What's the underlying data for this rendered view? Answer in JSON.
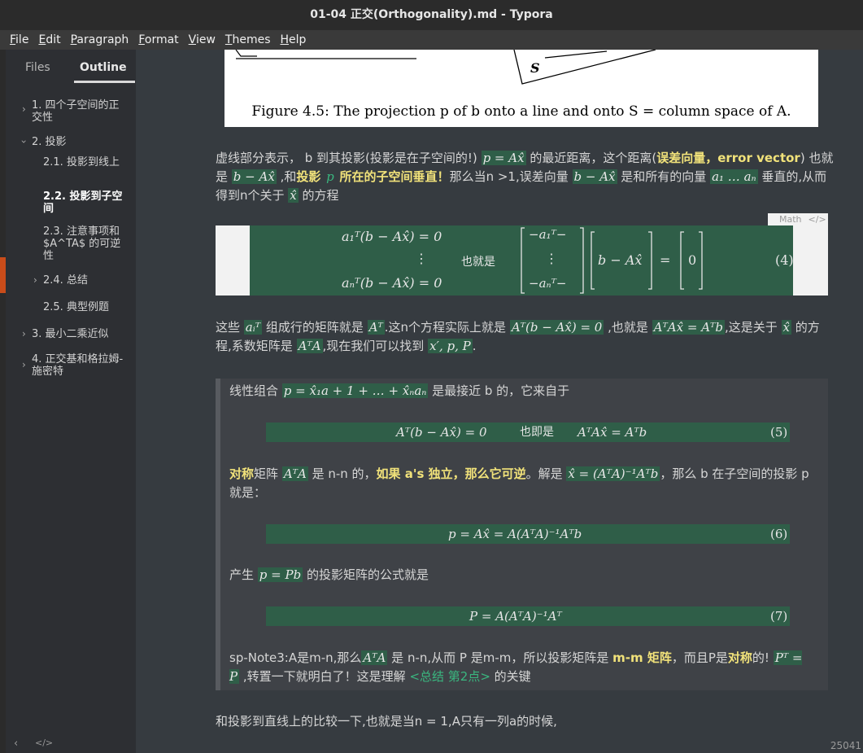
{
  "window": {
    "title": "01-04 正交(Orthogonality).md - Typora"
  },
  "menu": {
    "file": "File",
    "edit": "Edit",
    "paragraph": "Paragraph",
    "format": "Format",
    "view": "View",
    "themes": "Themes",
    "help": "Help"
  },
  "sidebar": {
    "tabs": {
      "files": "Files",
      "outline": "Outline"
    },
    "items": [
      {
        "label": "1. 四个子空间的正交性"
      },
      {
        "label": "2. 投影"
      },
      {
        "label": "2.1. 投影到线上"
      },
      {
        "label": "2.2. 投影到子空间"
      },
      {
        "label": "2.3. 注意事项和 $A^TA$ 的可逆性"
      },
      {
        "label": "2.4. 总结"
      },
      {
        "label": "2.5. 典型例题"
      },
      {
        "label": "3. 最小二乘近似"
      },
      {
        "label": "4. 正交基和格拉姆-施密特"
      }
    ]
  },
  "figure": {
    "caption": "Figure 4.5: The projection p of b onto a line and onto S = column space of A.",
    "s_label": "S"
  },
  "para1": {
    "a": "虚线部分表示， b 到其投影(投影是在子空间的!)",
    "m1": "p = Ax̂",
    "b": "的最近距离，这个距离(",
    "hl1": "误差向量，error vector",
    "c": ")",
    "d": "也就是",
    "m2": "b − Ax̂",
    "e": ",和",
    "hl2": "投影",
    "p": "p",
    "hl3": "所在的子空间垂直！",
    "f": "那么当n >1,误差向量",
    "m3": "b − Ax̂",
    "g": "是和所有的向量",
    "m4": "a₁ … aₙ",
    "h": "垂直的,从而得到n个关于",
    "m5": "x̂",
    "i": "的方程"
  },
  "math1": {
    "label": "Math",
    "row1": "a₁ᵀ(b − Ax̂) = 0",
    "dots": "⋮",
    "rowN": "aₙᵀ(b − Ax̂) = 0",
    "middle": "也就是",
    "mat_r1": "−a₁ᵀ−",
    "mat_r2": "⋮",
    "mat_r3": "−aₙᵀ−",
    "vec": "b − Ax̂",
    "eq": "=",
    "zero": "0",
    "num": "(4)"
  },
  "para2": {
    "a": "这些",
    "m1": "aᵢᵀ",
    "b": "组成行的矩阵就是",
    "m2": "Aᵀ",
    "c": ".这n个方程实际上就是",
    "m3": "Aᵀ(b − Ax̂) = 0",
    "d": ",也就是",
    "m4": "AᵀAx̂ = Aᵀb",
    "e": ",这是关于",
    "m5": "x̂",
    "f": "的方程,系数矩阵是",
    "m6": "AᵀA",
    "g": ",现在我们可以找到",
    "m7": "x′, p, P",
    "h": "."
  },
  "quote": {
    "l1a": "线性组合",
    "l1m": "p = x̂₁a + 1 + … + x̂ₙaₙ",
    "l1b": "是最接近 b 的，它来自于",
    "eq5a": "Aᵀ(b − Ax̂) = 0",
    "eq5mid": "也即是",
    "eq5b": "AᵀAx̂ = Aᵀb",
    "eq5n": "(5)",
    "l2hl": "对称",
    "l2a": "矩阵",
    "l2m1": "AᵀA",
    "l2b": "是 n-n 的，",
    "l2hl2": "如果 a's 独立，那么它可逆",
    "l2c": "。解是",
    "l2m2": "x̂ = (AᵀA)⁻¹Aᵀb",
    "l2d": "，那么 b 在子空间的投影 p 就是：",
    "eq6": "p = Ax̂ = A(AᵀA)⁻¹Aᵀb",
    "eq6n": "(6)",
    "l3a": "产生",
    "l3m": "p = Pb",
    "l3b": "的投影矩阵的公式就是",
    "eq7": "P = A(AᵀA)⁻¹Aᵀ",
    "eq7n": "(7)",
    "l4a": "sp-Note3:A是m-n,那么",
    "l4m1": "AᵀA",
    "l4b": "是 n-n,从而 P 是m-m，所以投影矩阵是",
    "l4hl1": "m-m 矩阵",
    "l4c": "，而且P是",
    "l4hl2": "对称",
    "l4d": "的!",
    "l5m": "Pᵀ = P",
    "l5a": ",转置一下就明白了！这是理解",
    "l5link": "<总结  第2点>",
    "l5b": "的关键"
  },
  "para3": {
    "text": "和投影到直线上的比较一下,也就是当n = 1,A只有一列a的时候,"
  },
  "status": {
    "word_count": "25041"
  }
}
